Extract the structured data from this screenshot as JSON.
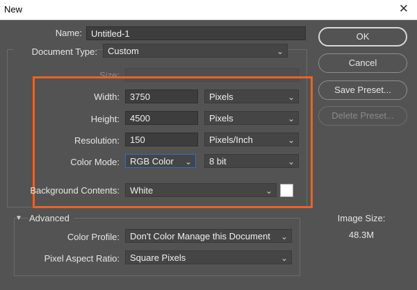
{
  "window": {
    "title": "New",
    "close_glyph": "✕"
  },
  "name": {
    "label": "Name:",
    "value": "Untitled-1"
  },
  "document_type": {
    "label": "Document Type:",
    "value": "Custom"
  },
  "size": {
    "label": "Size:",
    "value": ""
  },
  "width": {
    "label": "Width:",
    "value": "3750",
    "unit": "Pixels"
  },
  "height": {
    "label": "Height:",
    "value": "4500",
    "unit": "Pixels"
  },
  "resolution": {
    "label": "Resolution:",
    "value": "150",
    "unit": "Pixels/Inch"
  },
  "color_mode": {
    "label": "Color Mode:",
    "value": "RGB Color",
    "depth": "8 bit"
  },
  "background": {
    "label": "Background Contents:",
    "value": "White",
    "swatch_color": "#ffffff"
  },
  "advanced": {
    "label": "Advanced"
  },
  "color_profile": {
    "label": "Color Profile:",
    "value": "Don't Color Manage this Document"
  },
  "pixel_aspect": {
    "label": "Pixel Aspect Ratio:",
    "value": "Square Pixels"
  },
  "buttons": {
    "ok": "OK",
    "cancel": "Cancel",
    "save_preset": "Save Preset...",
    "delete_preset": "Delete Preset..."
  },
  "image_size": {
    "label": "Image Size:",
    "value": "48.3M"
  },
  "icons": {
    "chevron": "chevron-down-icon",
    "close": "close-icon",
    "disclosure": "triangle-down-icon"
  },
  "colors": {
    "highlight": "#f0621d",
    "background": "#535353",
    "focus": "#2f6fd0"
  }
}
